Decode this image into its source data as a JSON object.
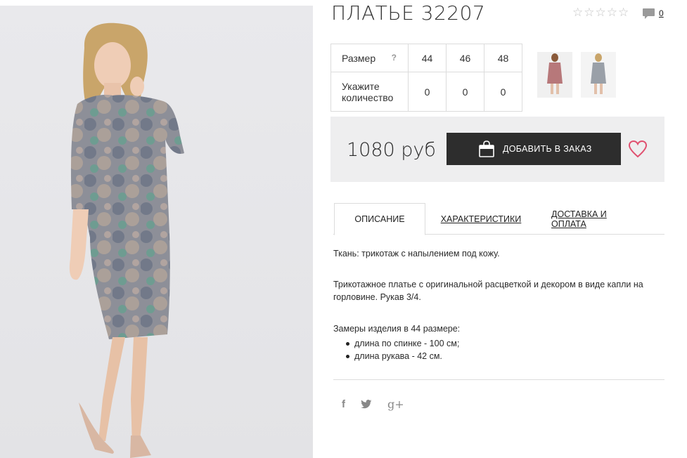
{
  "product": {
    "title": "ПЛАТЬЕ 32207",
    "comments_count": "0",
    "rating_stars": [
      "☆",
      "☆",
      "☆",
      "☆",
      "☆"
    ]
  },
  "sizes": {
    "size_label": "Размер",
    "help_label": "?",
    "quantity_label": "Укажите количество",
    "columns": [
      "44",
      "46",
      "48"
    ],
    "quantities": [
      "0",
      "0",
      "0"
    ]
  },
  "price": {
    "value": "1080 руб",
    "add_button": "ДОБАВИТЬ В ЗАКАЗ"
  },
  "tabs": {
    "description": "ОПИСАНИЕ",
    "characteristics": "ХАРАКТЕРИСТИКИ",
    "delivery": "ДОСТАВКА И ОПЛАТА"
  },
  "description": {
    "fabric": "Ткань: трикотаж с напылением под кожу.",
    "text": "Трикотажное платье с оригинальной расцветкой и декором в виде капли на горловине. Рукав 3/4.",
    "measurements_title": "Замеры изделия в 44 размере:",
    "measurements": [
      "длина по спинке - 100 см;",
      "длина рукава - 42 см."
    ]
  },
  "social": {
    "facebook": "f",
    "google": "g+"
  },
  "colors": {
    "button_bg": "#2d2d2d",
    "heart": "#e0506f",
    "price_bg": "#eeeeef"
  }
}
